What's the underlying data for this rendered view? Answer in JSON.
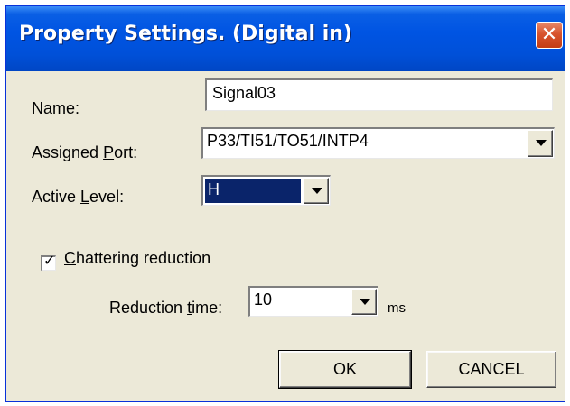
{
  "window": {
    "title": "Property Settings. (Digital in)",
    "close_glyph": "✕"
  },
  "form": {
    "name": {
      "label_key": "N",
      "label_rest": "ame:",
      "value": "Signal03"
    },
    "assigned_port": {
      "label_pre": "Assigned ",
      "label_key": "P",
      "label_rest": "ort:",
      "value": "P33/TI51/TO51/INTP4"
    },
    "active_level": {
      "label_pre": "Active ",
      "label_key": "L",
      "label_rest": "evel:",
      "value": "H"
    },
    "chattering": {
      "checked": true,
      "check_glyph": "✓",
      "label_key": "C",
      "label_rest": "hattering reduction"
    },
    "reduction_time": {
      "label_pre": "Reduction ",
      "label_key": "t",
      "label_rest": "ime:",
      "value": "10",
      "unit": "ms"
    }
  },
  "buttons": {
    "ok": "OK",
    "cancel": "CANCEL"
  },
  "icons": {
    "dropdown": "chevron-down-icon",
    "close": "close-icon",
    "check": "check-icon"
  }
}
